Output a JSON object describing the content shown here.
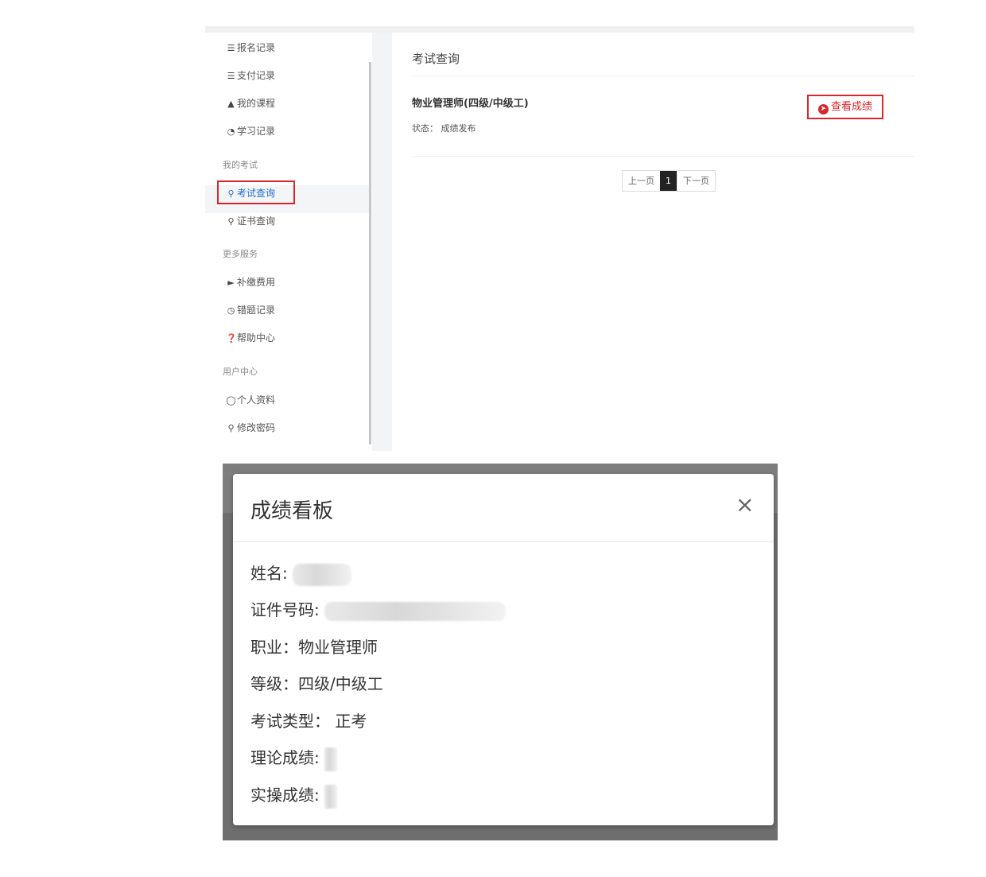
{
  "sidebar": {
    "items": [
      {
        "label": "报名记录",
        "icon": "list-icon"
      },
      {
        "label": "支付记录",
        "icon": "list-icon"
      },
      {
        "label": "我的课程",
        "icon": "graduation-cap-icon"
      },
      {
        "label": "学习记录",
        "icon": "pie-chart-icon"
      }
    ],
    "groups": {
      "exam": {
        "label": "我的考试",
        "items": [
          {
            "label": "考试查询",
            "icon": "search-icon",
            "active": true
          },
          {
            "label": "证书查询",
            "icon": "search-icon"
          }
        ]
      },
      "services": {
        "label": "更多服务",
        "items": [
          {
            "label": "补缴费用",
            "icon": "tags-icon"
          },
          {
            "label": "错题记录",
            "icon": "clock-icon"
          },
          {
            "label": "帮助中心",
            "icon": "question-circle-icon"
          }
        ]
      },
      "user": {
        "label": "用户中心",
        "items": [
          {
            "label": "个人资料",
            "icon": "user-icon"
          },
          {
            "label": "修改密码",
            "icon": "key-icon"
          }
        ]
      }
    }
  },
  "main": {
    "title": "考试查询",
    "exam": {
      "name": "物业管理师(四级/中级工)",
      "status": "状态：  成绩发布",
      "view_button": "查看成绩"
    },
    "pagination": {
      "prev": "上一页",
      "current": "1",
      "next": "下一页"
    }
  },
  "modal": {
    "title": "成绩看板",
    "close": "×",
    "fields": {
      "name_label": "姓名:",
      "id_label": "证件号码:",
      "occupation": "职业：物业管理师",
      "level": "等级：四级/中级工",
      "exam_type": "考试类型：  正考",
      "theory_label": "理论成绩:",
      "practical_label": "实操成绩:"
    }
  },
  "colors": {
    "accent_red": "#d9262c",
    "active_blue": "#1f6fd0",
    "overlay_gray": "#7d7d7d"
  }
}
